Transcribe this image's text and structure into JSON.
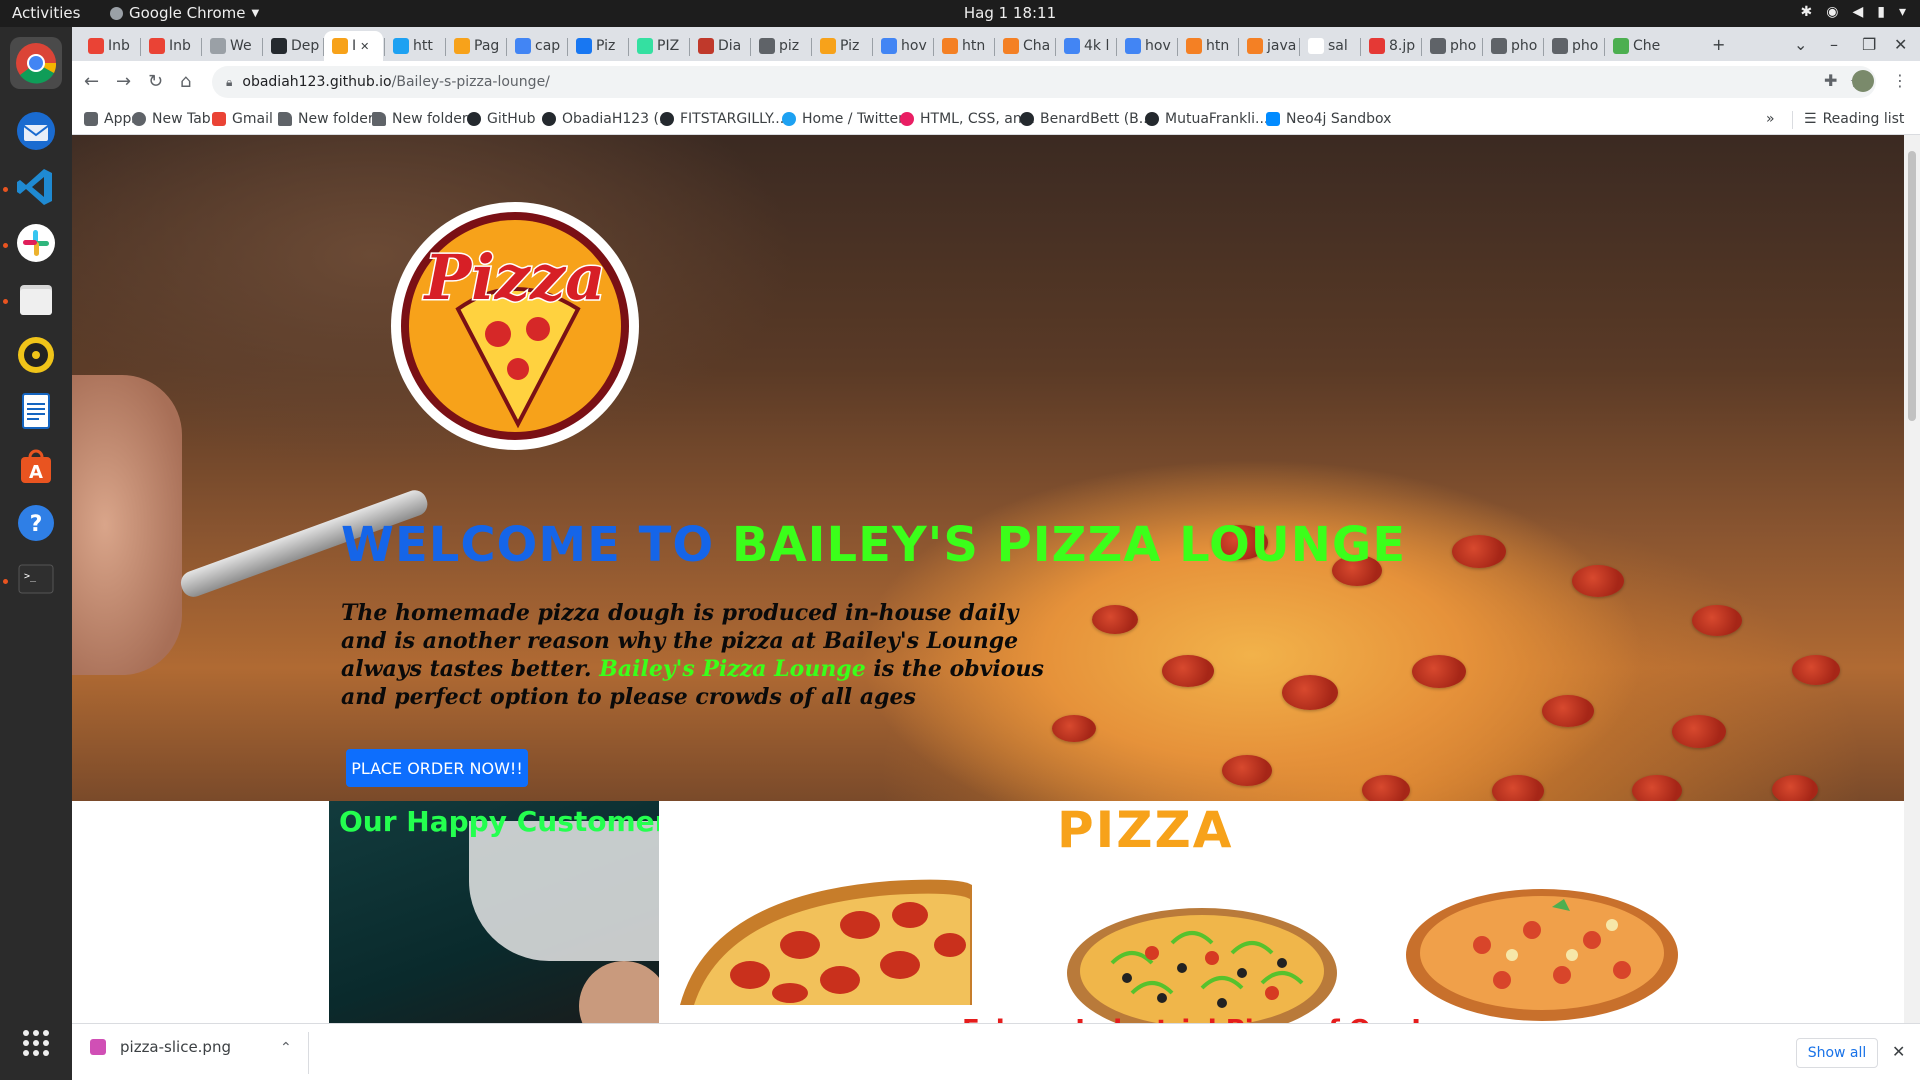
{
  "os": {
    "activities": "Activities",
    "app_name": "Google Chrome",
    "clock": "Hag 1  18:11"
  },
  "tabs": [
    {
      "label": "Inb",
      "icon": "gmail-icon",
      "color": "#ea4335"
    },
    {
      "label": "Inb",
      "icon": "gmail-icon",
      "color": "#ea4335"
    },
    {
      "label": "We",
      "icon": "web-icon",
      "color": "#9aa0a6"
    },
    {
      "label": "Dep",
      "icon": "github-icon",
      "color": "#24292e"
    },
    {
      "label": "I",
      "icon": "pizza-icon",
      "color": "#f7a21a",
      "active": true
    },
    {
      "label": "htt",
      "icon": "twitter-icon",
      "color": "#1da1f2"
    },
    {
      "label": "Pag",
      "icon": "pizza-icon",
      "color": "#f7a21a"
    },
    {
      "label": "cap",
      "icon": "google-icon",
      "color": "#4285f4"
    },
    {
      "label": "Piz",
      "icon": "facebook-icon",
      "color": "#1877f2"
    },
    {
      "label": "PIZ",
      "icon": "tripadvisor-icon",
      "color": "#34e0a1"
    },
    {
      "label": "Dia",
      "icon": "menu-icon",
      "color": "#c0392b"
    },
    {
      "label": "piz",
      "icon": "web-icon",
      "color": "#5f6368"
    },
    {
      "label": "Piz",
      "icon": "pizza-icon",
      "color": "#f7a21a"
    },
    {
      "label": "hov",
      "icon": "google-icon",
      "color": "#4285f4"
    },
    {
      "label": "htn",
      "icon": "stackoverflow-icon",
      "color": "#f48024"
    },
    {
      "label": "Cha",
      "icon": "stackoverflow-icon",
      "color": "#f48024"
    },
    {
      "label": "4k l",
      "icon": "google-icon",
      "color": "#4285f4"
    },
    {
      "label": "hov",
      "icon": "google-icon",
      "color": "#4285f4"
    },
    {
      "label": "htn",
      "icon": "stackoverflow-icon",
      "color": "#f48024"
    },
    {
      "label": "java",
      "icon": "stackoverflow-icon",
      "color": "#f48024"
    },
    {
      "label": "sal",
      "icon": "blank-icon",
      "color": "#ffffff"
    },
    {
      "label": "8.jp",
      "icon": "image-icon",
      "color": "#e53935"
    },
    {
      "label": "pho",
      "icon": "web-icon",
      "color": "#5f6368"
    },
    {
      "label": "pho",
      "icon": "web-icon",
      "color": "#5f6368"
    },
    {
      "label": "pho",
      "icon": "web-icon",
      "color": "#5f6368"
    },
    {
      "label": "Che",
      "icon": "shopify-icon",
      "color": "#4caf50"
    }
  ],
  "address": {
    "host": "obadiah123.github.io",
    "path": "/Bailey-s-pizza-lounge/"
  },
  "bookmarks": [
    {
      "label": "Apps",
      "icon": "apps-grid-icon",
      "color": "#5f6368"
    },
    {
      "label": "New Tab",
      "icon": "web-icon",
      "color": "#5f6368"
    },
    {
      "label": "Gmail",
      "icon": "gmail-icon",
      "color": "#ea4335"
    },
    {
      "label": "New folder",
      "icon": "folder-icon",
      "color": "#5f6368"
    },
    {
      "label": "New folder",
      "icon": "folder-icon",
      "color": "#5f6368"
    },
    {
      "label": "GitHub",
      "icon": "github-icon",
      "color": "#24292e"
    },
    {
      "label": "ObadiaH123 (...",
      "icon": "github-icon",
      "color": "#24292e"
    },
    {
      "label": "FITSTARGILLY...",
      "icon": "github-icon",
      "color": "#24292e"
    },
    {
      "label": "Home / Twitter",
      "icon": "twitter-icon",
      "color": "#1da1f2"
    },
    {
      "label": "HTML, CSS, an...",
      "icon": "web-icon",
      "color": "#e91e63"
    },
    {
      "label": "BenardBett (B...",
      "icon": "github-icon",
      "color": "#24292e"
    },
    {
      "label": "MutuaFrankli...",
      "icon": "github-icon",
      "color": "#24292e"
    },
    {
      "label": "Neo4j Sandbox",
      "icon": "neo4j-icon",
      "color": "#018bff"
    }
  ],
  "bookmarks_more": "»",
  "reading_list": "Reading list",
  "page": {
    "logo_text": "Pizza",
    "hero_title_part1": "WELCOME TO",
    "hero_title_part2": "BAILEY'S PIZZA LOUNGE",
    "hero_desc_part1": "The homemade pizza dough is produced in-house daily and is another reason why the pizza at Bailey's Lounge always tastes better.",
    "hero_desc_highlight": "Bailey's Pizza Lounge",
    "hero_desc_part2": "is the obvious and perfect option to please crowds of all ages",
    "order_button": "PLACE ORDER NOW!!",
    "customer_heading": "Our Happy Customer",
    "pizza_heading": "PIZZA",
    "sub_heading": "Fabous Industrial Pizza of Our Lounge"
  },
  "download": {
    "filename": "pizza-slice.png",
    "show_all": "Show all"
  },
  "colors": {
    "title_blue": "#1565e8",
    "title_green": "#3bff1a",
    "button_blue": "#0d6efd",
    "pizza_orange": "#f7a21a"
  }
}
